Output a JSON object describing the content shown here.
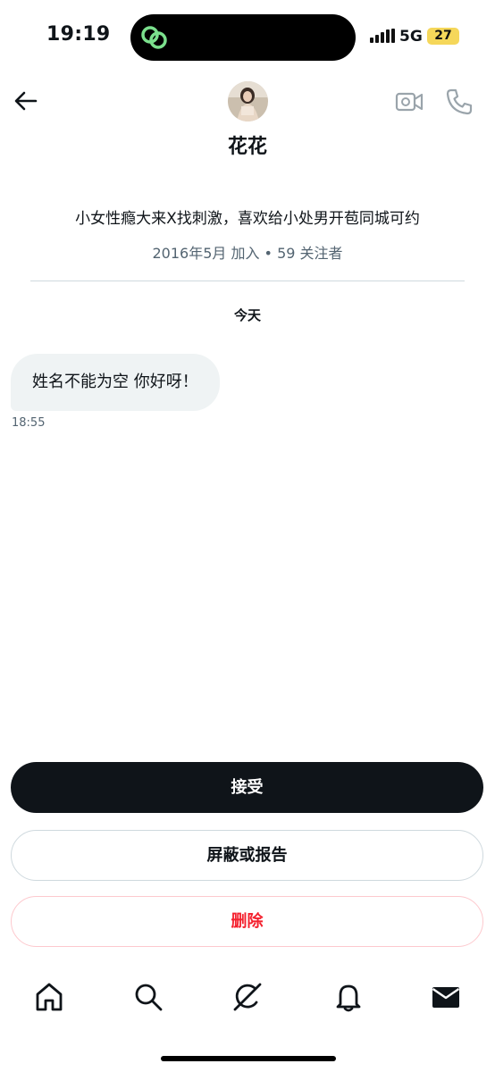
{
  "status_bar": {
    "time": "19:19",
    "network": "5G",
    "battery": "27",
    "battery_color": "#f5d75a"
  },
  "header": {
    "name": "花花",
    "back_icon": "arrow-left-icon",
    "video_icon": "video-camera-icon",
    "phone_icon": "phone-icon"
  },
  "profile": {
    "bio": "小女性瘾大来X找刺激，喜欢给小处男开苞同城可约",
    "meta": "2016年5月 加入 • 59 关注者"
  },
  "conversation": {
    "date_separator": "今天",
    "messages": [
      {
        "text": "姓名不能为空 你好呀！",
        "time": "18:55"
      }
    ]
  },
  "actions": {
    "accept": "接受",
    "block_or_report": "屏蔽或报告",
    "delete": "删除",
    "delete_color": "#f4212e"
  },
  "bottom_nav": {
    "items": [
      "home-icon",
      "search-icon",
      "grok-icon",
      "notifications-bell-icon",
      "messages-envelope-icon"
    ]
  }
}
